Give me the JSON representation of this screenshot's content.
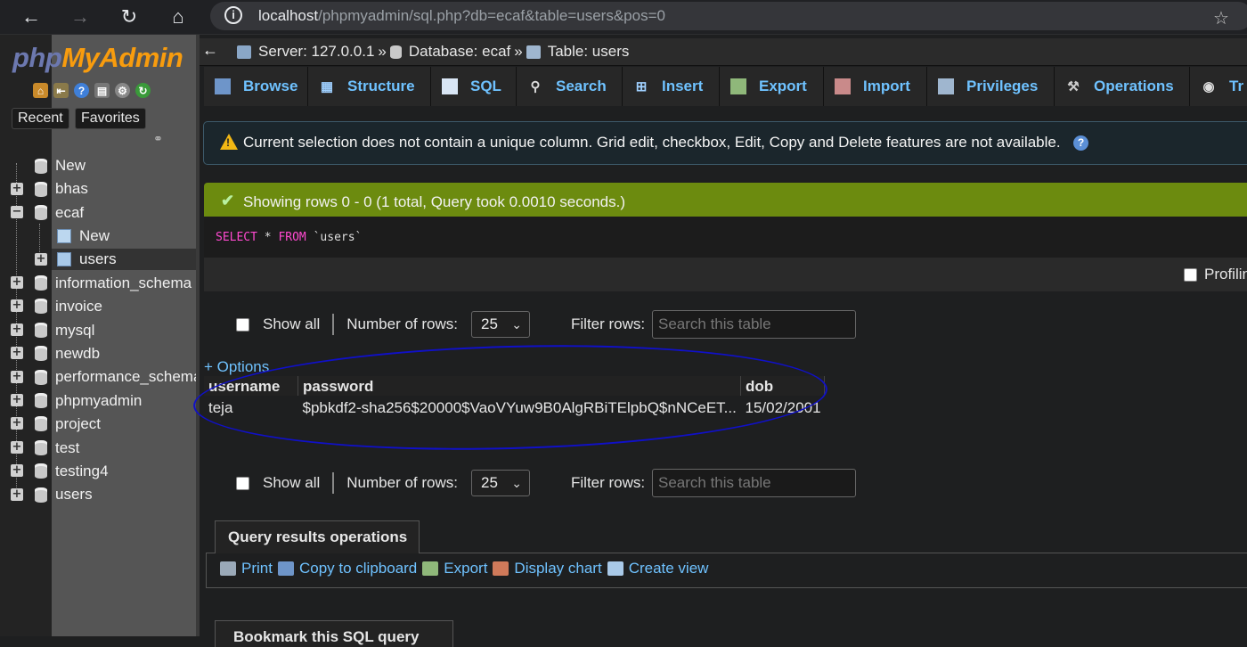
{
  "browser": {
    "url_host": "localhost",
    "url_path": "/phpmyadmin/sql.php?db=ecaf&table=users&pos=0",
    "icons": [
      "back-arrow-icon",
      "forward-arrow-icon",
      "reload-icon",
      "home-icon",
      "site-info-icon",
      "add-favorite-icon"
    ]
  },
  "sidebar": {
    "logo_php": "php",
    "logo_myadmin": "MyAdmin",
    "recent_label": "Recent",
    "favorites_label": "Favorites",
    "tree": {
      "new_label": "New",
      "databases": [
        "bhas",
        "ecaf",
        "information_schema",
        "invoice",
        "mysql",
        "newdb",
        "performance_schema",
        "phpmyadmin",
        "project",
        "test",
        "testing4",
        "users"
      ],
      "ecaf_children": {
        "new_label": "New",
        "table": "users"
      }
    }
  },
  "breadcrumb": {
    "server": "Server: 127.0.0.1",
    "database": "Database: ecaf",
    "table": "Table: users",
    "separator": "»"
  },
  "tabs": [
    "Browse",
    "Structure",
    "SQL",
    "Search",
    "Insert",
    "Export",
    "Import",
    "Privileges",
    "Operations",
    "Tr"
  ],
  "notice": {
    "text": "Current selection does not contain a unique column. Grid edit, checkbox, Edit, Copy and Delete features are not available."
  },
  "success": {
    "text": "Showing rows 0 - 0 (1 total, Query took 0.0010 seconds.)"
  },
  "sql": {
    "kw_select": "SELECT",
    "star": " * ",
    "kw_from": "FROM",
    "table": " `users`"
  },
  "profiling_label": "Profilin",
  "controls": {
    "show_all": "Show all",
    "number_of_rows_label": "Number of rows:",
    "rows_value": "25",
    "filter_label": "Filter rows:",
    "filter_placeholder": "Search this table"
  },
  "results": {
    "options_label": "+ Options",
    "columns": [
      "username",
      "password",
      "dob"
    ],
    "rows": [
      [
        "teja",
        "$pbkdf2-sha256$20000$VaoVYuw9B0AlgRBiTElpbQ$nNCeET...",
        "15/02/2001"
      ]
    ]
  },
  "query_ops": {
    "title": "Query results operations",
    "links": [
      "Print",
      "Copy to clipboard",
      "Export",
      "Display chart",
      "Create view"
    ]
  },
  "bookmark_title": "Bookmark this SQL query",
  "colors": {
    "link": "#6fc2ff",
    "success_bg": "#6c8b0f",
    "annotation_circle": "#1010c8",
    "sql_keyword": "#ff49d0"
  }
}
